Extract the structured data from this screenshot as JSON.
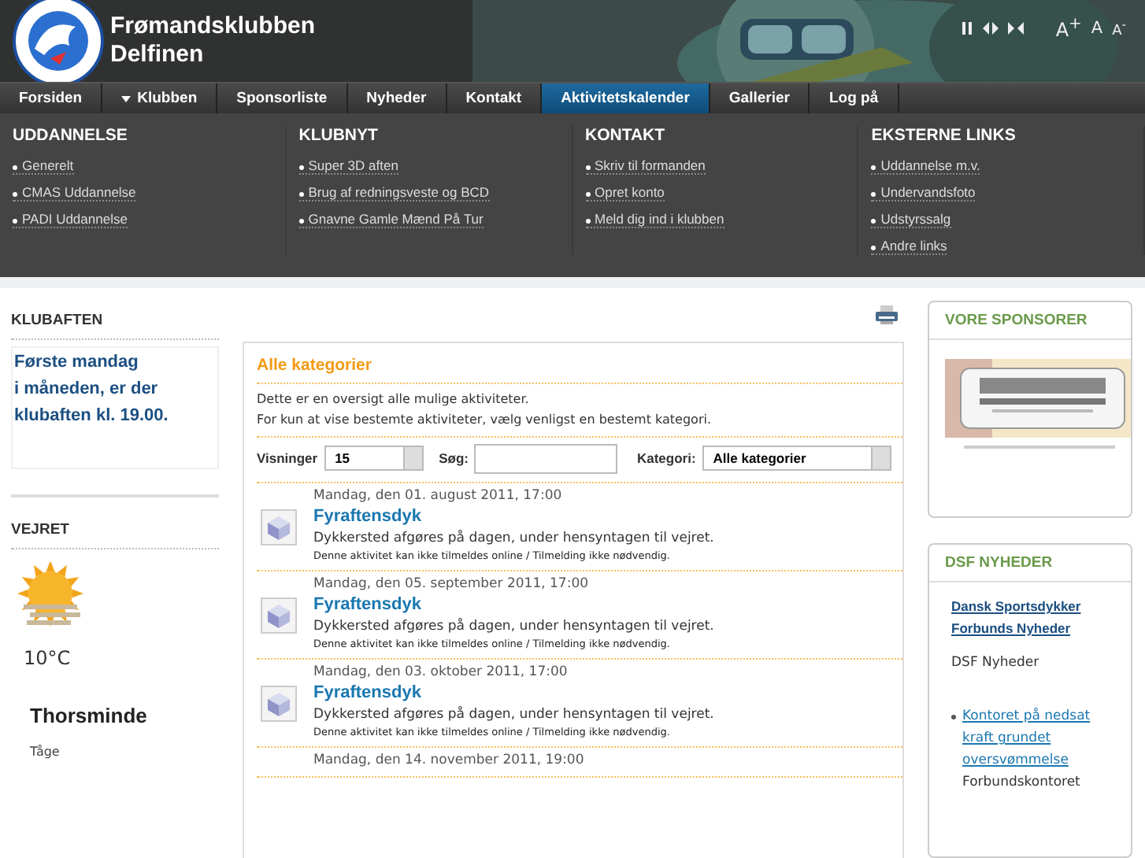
{
  "header": {
    "title_lines": [
      "Frømandsklubben",
      "Delfinen"
    ],
    "font_controls": [
      "A$^{+}$",
      "A",
      "A$^{-}$"
    ]
  },
  "nav": [
    {
      "label": "Forsiden",
      "selected": false,
      "has_menu": false
    },
    {
      "label": "Klubben",
      "selected": false,
      "has_menu": true
    },
    {
      "label": "Sponsorliste",
      "selected": false,
      "has_menu": false
    },
    {
      "label": "Nyheder",
      "selected": false,
      "has_menu": false
    },
    {
      "label": "Kontakt",
      "selected": false,
      "has_menu": false
    },
    {
      "label": "Aktivitetskalender",
      "selected": true,
      "has_menu": false
    },
    {
      "label": "Gallerier",
      "selected": false,
      "has_menu": false
    },
    {
      "label": "Log på",
      "selected": false,
      "has_menu": false
    }
  ],
  "mega_menu": [
    {
      "heading": "UDDANNELSE",
      "links": [
        "Generelt",
        "CMAS Uddannelse",
        "PADI Uddannelse"
      ]
    },
    {
      "heading": "KLUBNYT",
      "links": [
        "Super 3D aften",
        "Brug af redningsveste og BCD",
        "Gnavne Gamle Mænd På Tur"
      ]
    },
    {
      "heading": "KONTAKT",
      "links": [
        "Skriv til formanden",
        "Opret konto",
        "Meld dig ind i klubben"
      ]
    },
    {
      "heading": "EKSTERNE LINKS",
      "links": [
        "Uddannelse m.v.",
        "Undervandsfoto",
        "Udstyrssalg",
        "Andre links"
      ]
    }
  ],
  "left": {
    "klubaften": {
      "heading": "KLUBAFTEN",
      "lines": [
        "Første mandag",
        "i måneden, er der",
        "klubaften kl. 19.00."
      ]
    },
    "weather": {
      "heading": "VEJRET",
      "temperature": "10°C",
      "place": "Thorsminde",
      "condition": "Tåge"
    }
  },
  "main": {
    "title": "Alle kategorier",
    "description": [
      "Dette er en oversigt alle mulige aktiviteter.",
      "For kun at vise bestemte aktiviteter, vælg venligst en bestemt kategori."
    ],
    "filters": {
      "views_label": "Visninger",
      "views_value": "15",
      "search_label": "Søg:",
      "category_label": "Kategori:",
      "category_value": "Alle kategorier"
    },
    "events": [
      {
        "date": "Mandag, den 01. august 2011, 17:00",
        "title": "Fyraftensdyk",
        "text": "Dykkersted afgøres på dagen, under hensyntagen til vejret.",
        "note": "Denne aktivitet kan ikke tilmeldes online / Tilmelding ikke nødvendig."
      },
      {
        "date": "Mandag, den 05. september 2011, 17:00",
        "title": "Fyraftensdyk",
        "text": "Dykkersted afgøres på dagen, under hensyntagen til vejret.",
        "note": "Denne aktivitet kan ikke tilmeldes online / Tilmelding ikke nødvendig."
      },
      {
        "date": "Mandag, den 03. oktober 2011, 17:00",
        "title": "Fyraftensdyk",
        "text": "Dykkersted afgøres på dagen, under hensyntagen til vejret.",
        "note": "Denne aktivitet kan ikke tilmeldes online / Tilmelding ikke nødvendig."
      },
      {
        "date": "Mandag, den 14. november 2011, 19:00"
      }
    ]
  },
  "right": {
    "sponsors": {
      "heading": "VORE SPONSORER"
    },
    "news": {
      "heading": "DSF NYHEDER",
      "feed_title": "Dansk Sportsdykker Forbunds Nyheder",
      "feed_name": "DSF Nyheder",
      "items": [
        {
          "title": "Kontoret på nedsat kraft grundet oversvømmelse",
          "text": "Forbundskontoret"
        }
      ]
    }
  }
}
